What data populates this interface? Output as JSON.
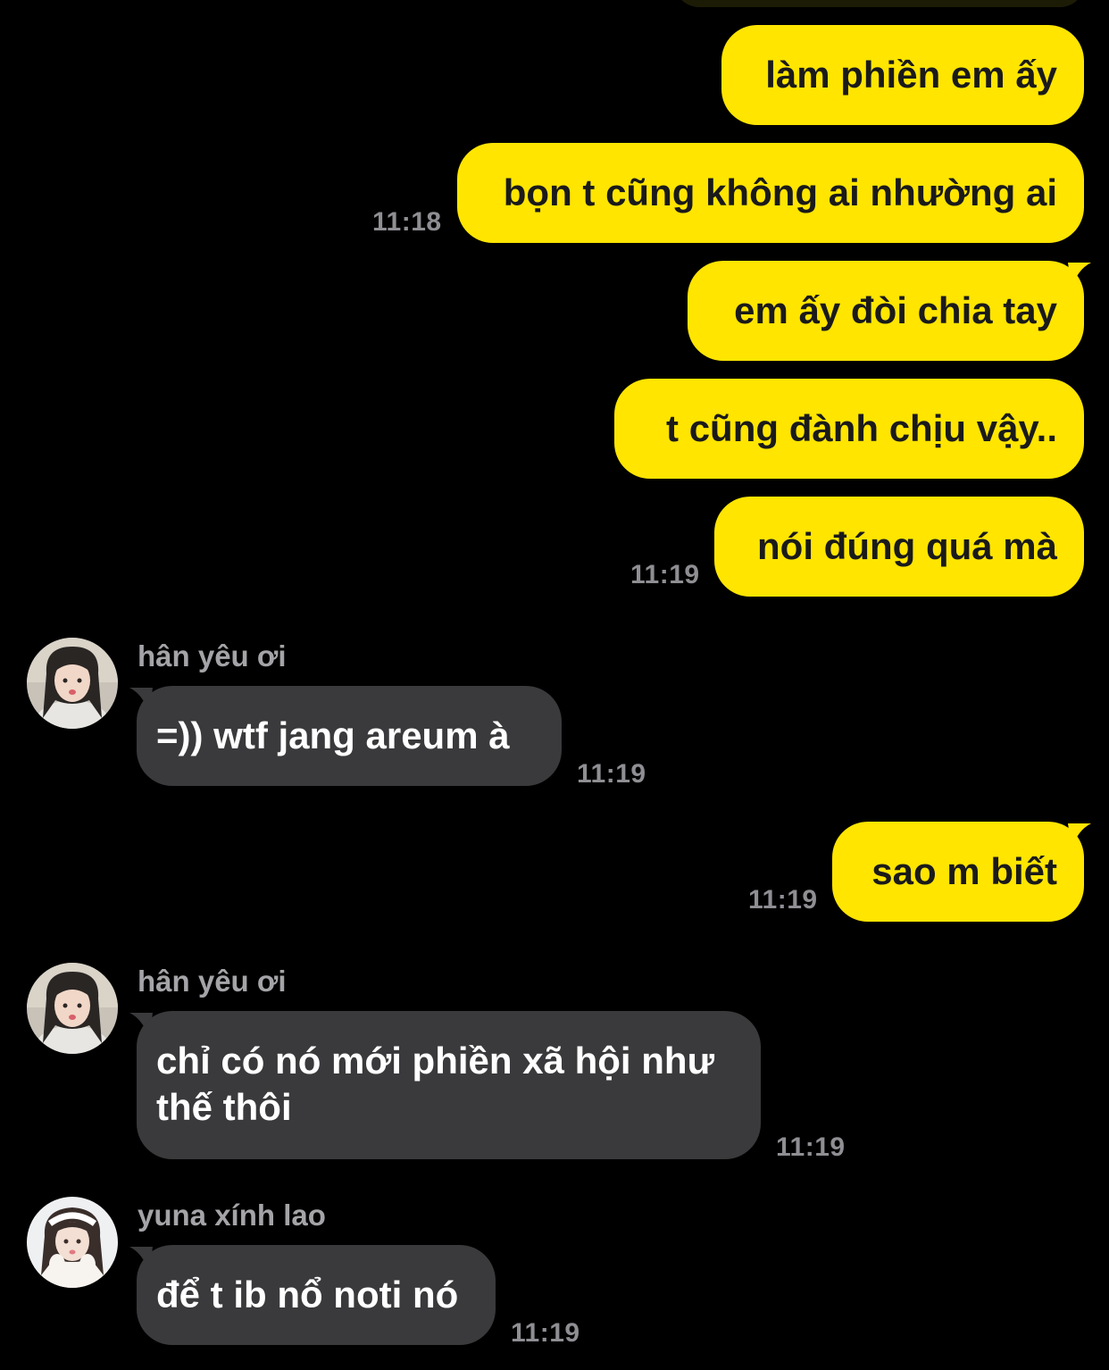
{
  "colors": {
    "background": "#000000",
    "outgoing_bubble": "#FFE500",
    "incoming_bubble": "#3a3a3c",
    "timestamp": "#8e8e93",
    "sender_name": "#a4a4a8"
  },
  "messages": [
    {
      "direction": "out",
      "text": "làm phiền em ấy"
    },
    {
      "direction": "out",
      "text": "bọn t cũng không ai nhường ai",
      "time": "11:18"
    },
    {
      "direction": "out",
      "text": "em ấy đòi chia tay"
    },
    {
      "direction": "out",
      "text": "t cũng đành chịu vậy.."
    },
    {
      "direction": "out",
      "text": "nói đúng quá mà",
      "time": "11:19"
    },
    {
      "direction": "in",
      "sender": "hân yêu ơi",
      "avatar": "avatar-han",
      "text": "=)) wtf jang areum à",
      "time": "11:19"
    },
    {
      "direction": "out",
      "text": "sao m biết",
      "time": "11:19"
    },
    {
      "direction": "in",
      "sender": "hân yêu ơi",
      "avatar": "avatar-han",
      "text": "chỉ có nó mới phiền xã hội như thế thôi",
      "time": "11:19"
    },
    {
      "direction": "in",
      "sender": "yuna xính lao",
      "avatar": "avatar-yuna",
      "text": "để t ib nổ noti nó",
      "time": "11:19"
    }
  ]
}
